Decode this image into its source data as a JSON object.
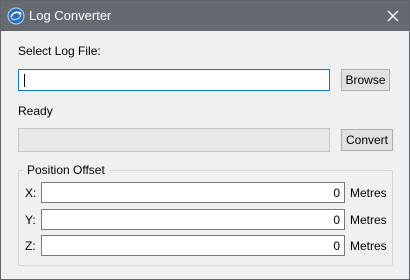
{
  "window": {
    "title": "Log Converter"
  },
  "file": {
    "label": "Select Log File:",
    "value": "",
    "browse_label": "Browse"
  },
  "status": {
    "text": "Ready",
    "progress": 0
  },
  "convert_label": "Convert",
  "offset": {
    "title": "Position Offset",
    "fields": [
      {
        "axis": "X:",
        "value": "0",
        "unit": "Metres"
      },
      {
        "axis": "Y:",
        "value": "0",
        "unit": "Metres"
      },
      {
        "axis": "Z:",
        "value": "0",
        "unit": "Metres"
      }
    ]
  },
  "colors": {
    "titlebar": "#646a70",
    "focus_border": "#0078d7"
  },
  "icons": {
    "app": "log-converter-icon",
    "close": "close-icon"
  }
}
